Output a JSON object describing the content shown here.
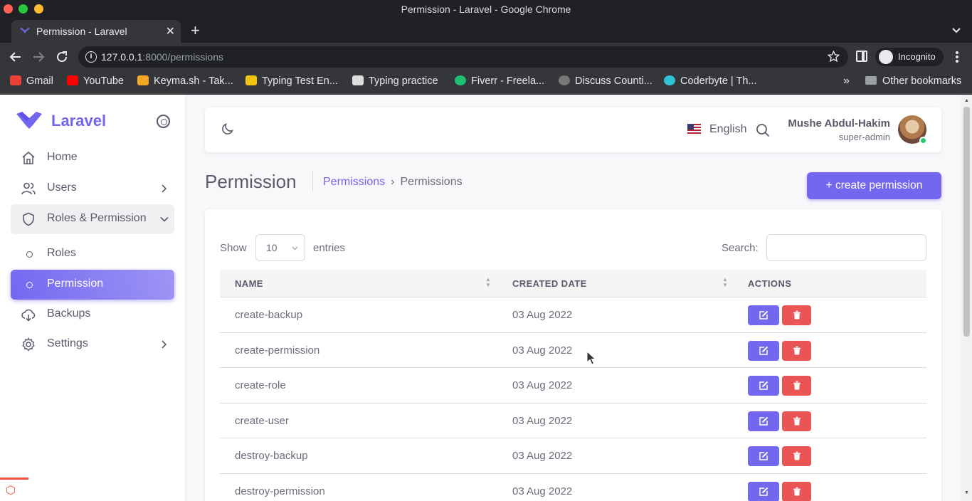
{
  "window": {
    "title": "Permission - Laravel - Google Chrome"
  },
  "tab": {
    "title": "Permission - Laravel",
    "close": "✕",
    "new": "+"
  },
  "address": {
    "host": "127.0.0.1",
    "rest": ":8000/permissions"
  },
  "incognito": {
    "label": "Incognito"
  },
  "bookmarks": {
    "items": [
      {
        "label": "Gmail",
        "color": "#ea4335"
      },
      {
        "label": "YouTube",
        "color": "#ff0000"
      },
      {
        "label": "Keyma.sh - Tak...",
        "color": "#f5a623"
      },
      {
        "label": "Typing Test En...",
        "color": "#f1c40f"
      },
      {
        "label": "Typing practice",
        "color": "#dddddd"
      },
      {
        "label": "Fiverr - Freela...",
        "color": "#1dbf73"
      },
      {
        "label": "Discuss Counti...",
        "color": "#777777"
      },
      {
        "label": "Coderbyte | Th...",
        "color": "#2ec4d6"
      }
    ],
    "more": "»",
    "other": "Other bookmarks"
  },
  "sidebar": {
    "brand": "Laravel",
    "accent": "#7367f0",
    "items": [
      {
        "label": "Home",
        "icon": "home-icon"
      },
      {
        "label": "Users",
        "icon": "users-icon"
      },
      {
        "label": "Roles & Permission",
        "icon": "shield-icon"
      },
      {
        "label": "Roles",
        "icon": "circle-icon"
      },
      {
        "label": "Permission",
        "icon": "circle-icon"
      },
      {
        "label": "Backups",
        "icon": "cloud-download-icon"
      },
      {
        "label": "Settings",
        "icon": "gear-icon"
      }
    ]
  },
  "navbar": {
    "language": "English",
    "user_name": "Mushe Abdul-Hakim",
    "user_role": "super-admin"
  },
  "header": {
    "title": "Permission",
    "crumb_link": "Permissions",
    "crumb_sep": "›",
    "crumb_current": "Permissions",
    "create_button": "+ create permission"
  },
  "table": {
    "show_label": "Show",
    "page_length": "10",
    "entries_label": "entries",
    "search_label": "Search:",
    "columns": [
      "NAME",
      "CREATED DATE",
      "ACTIONS"
    ],
    "rows": [
      {
        "name": "create-backup",
        "date": "03 Aug 2022"
      },
      {
        "name": "create-permission",
        "date": "03 Aug 2022"
      },
      {
        "name": "create-role",
        "date": "03 Aug 2022"
      },
      {
        "name": "create-user",
        "date": "03 Aug 2022"
      },
      {
        "name": "destroy-backup",
        "date": "03 Aug 2022"
      },
      {
        "name": "destroy-permission",
        "date": "03 Aug 2022"
      }
    ]
  },
  "colors": {
    "primary": "#7367f0",
    "danger": "#ea5455",
    "success": "#28c76f"
  }
}
